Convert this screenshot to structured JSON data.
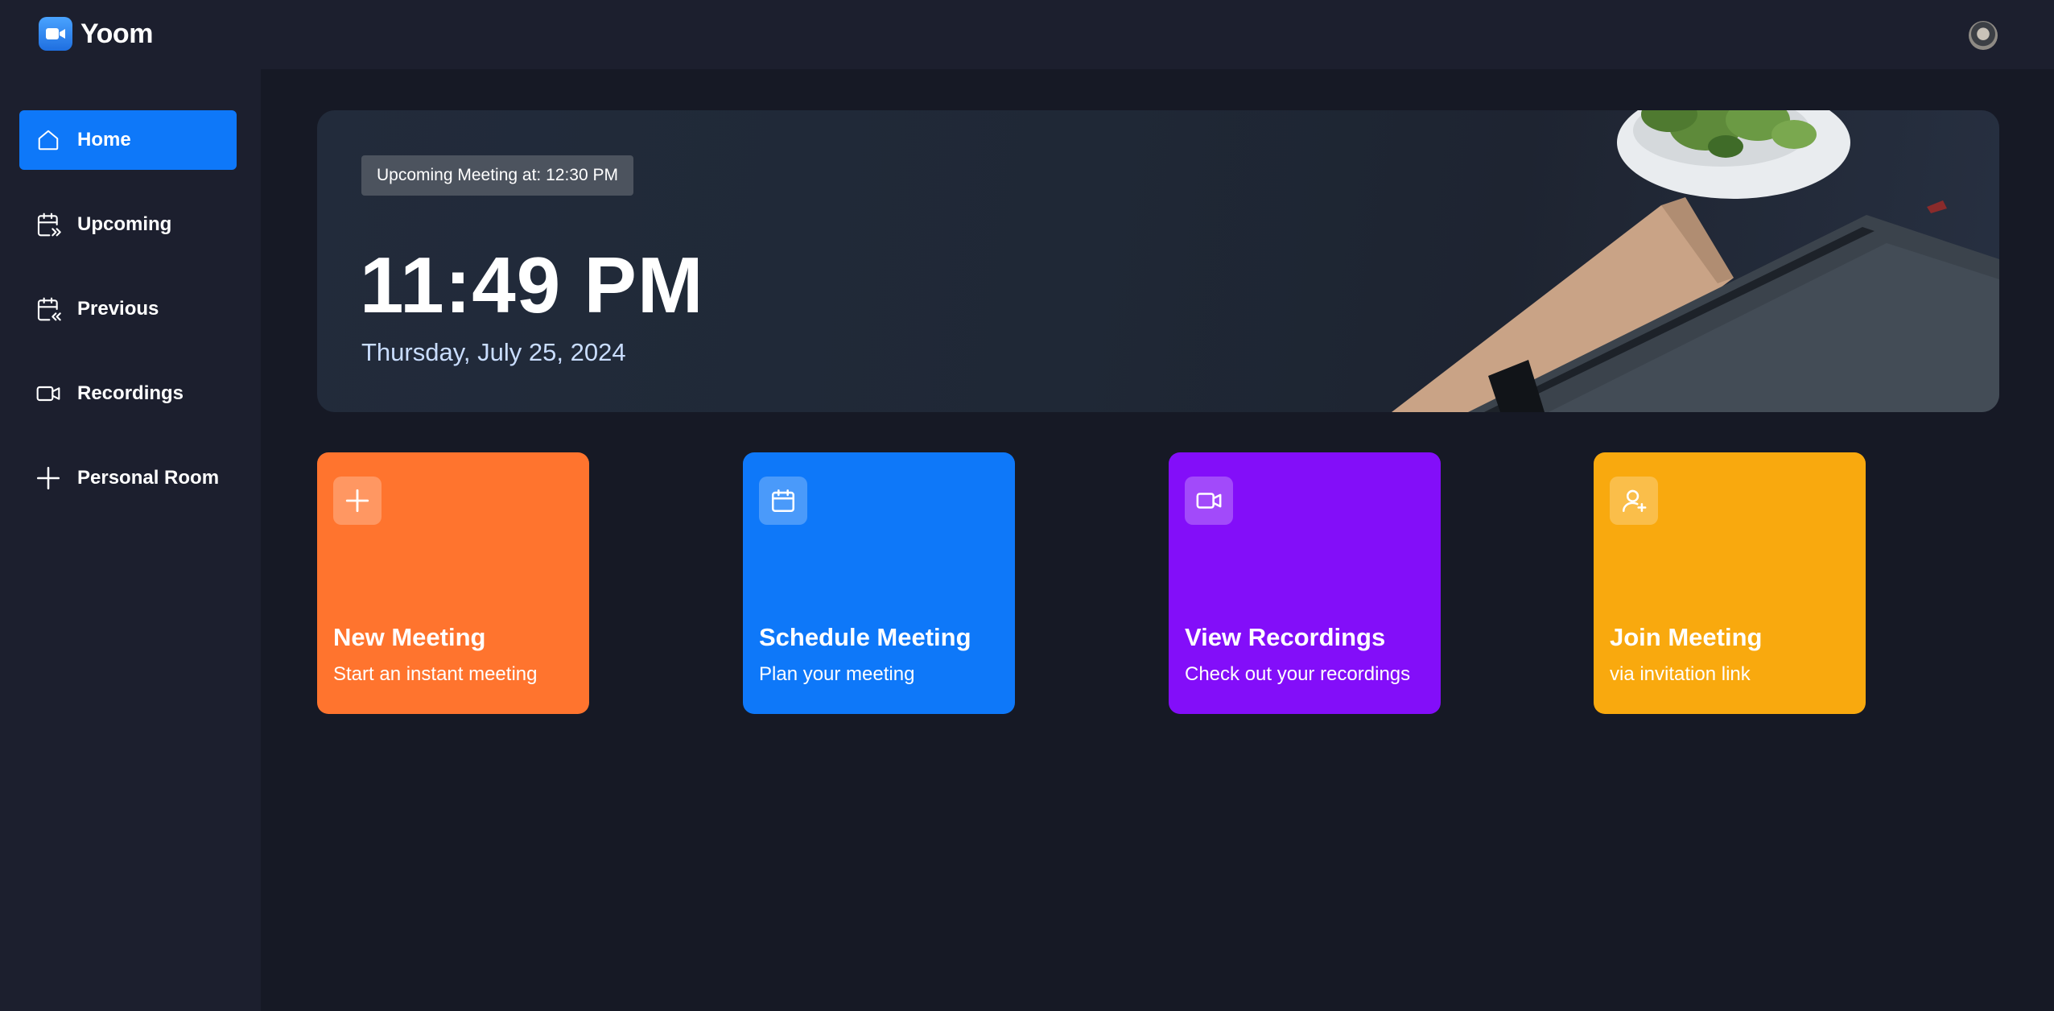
{
  "app": {
    "name": "Yoom"
  },
  "sidebar": {
    "items": [
      {
        "label": "Home",
        "icon": "home-icon",
        "active": true
      },
      {
        "label": "Upcoming",
        "icon": "calendar-upcoming-icon",
        "active": false
      },
      {
        "label": "Previous",
        "icon": "calendar-previous-icon",
        "active": false
      },
      {
        "label": "Recordings",
        "icon": "video-icon",
        "active": false
      },
      {
        "label": "Personal Room",
        "icon": "plus-icon",
        "active": false
      }
    ]
  },
  "hero": {
    "badge": "Upcoming Meeting at: 12:30 PM",
    "time": "11:49 PM",
    "date": "Thursday, July 25, 2024"
  },
  "cards": [
    {
      "title": "New Meeting",
      "subtitle": "Start an instant meeting",
      "icon": "plus-icon",
      "color": "#ff742e"
    },
    {
      "title": "Schedule Meeting",
      "subtitle": "Plan your meeting",
      "icon": "calendar-icon",
      "color": "#0e78f9"
    },
    {
      "title": "View Recordings",
      "subtitle": "Check out your recordings",
      "icon": "video-icon",
      "color": "#830ef9"
    },
    {
      "title": "Join Meeting",
      "subtitle": "via invitation link",
      "icon": "user-plus-icon",
      "color": "#f9a90e"
    }
  ],
  "colors": {
    "background": "#161925",
    "panel": "#1c1f2e",
    "accent": "#0e78f9"
  }
}
